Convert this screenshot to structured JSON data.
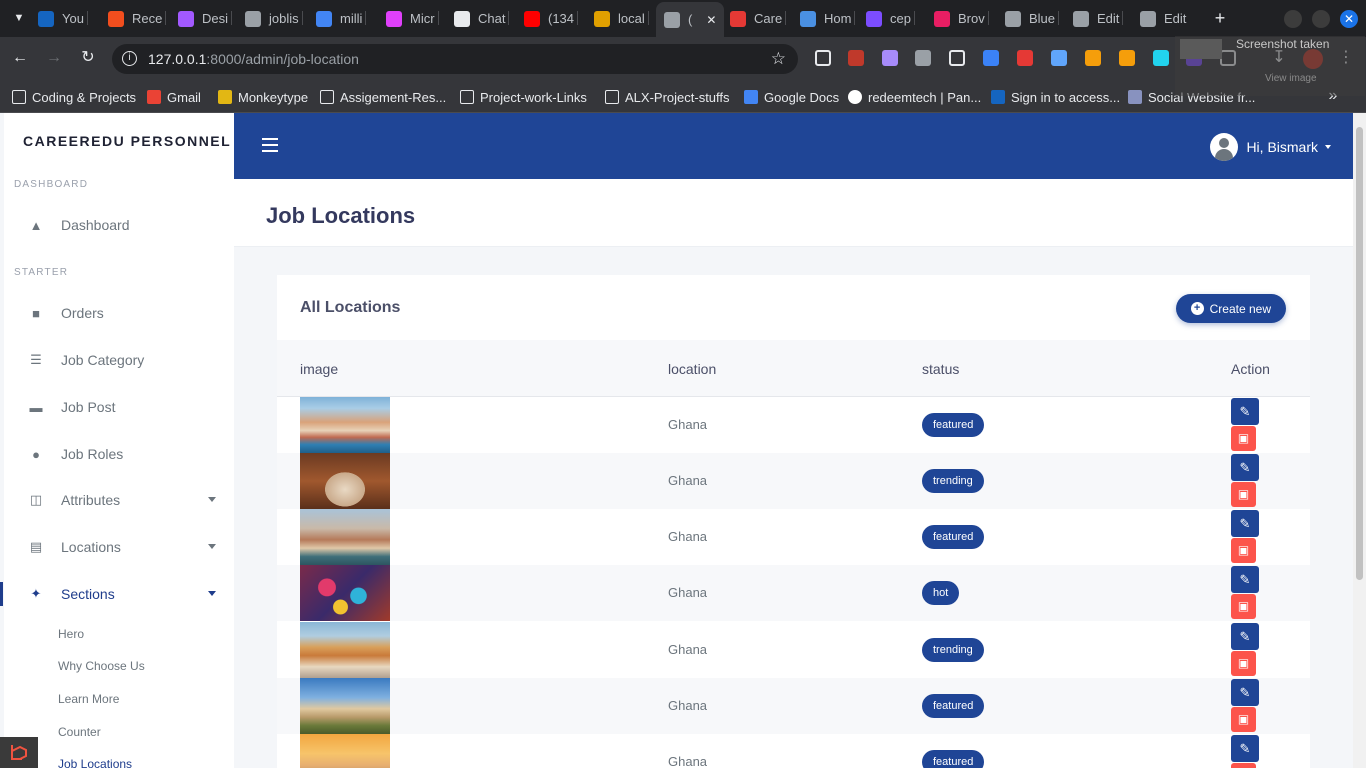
{
  "browser": {
    "tabs": [
      {
        "label": "You",
        "color": "#1565c0"
      },
      {
        "label": "Rece",
        "color": "#f24e1e"
      },
      {
        "label": "Desi",
        "color": "#a259ff"
      },
      {
        "label": "joblis",
        "color": "#9aa0a6"
      },
      {
        "label": "milli",
        "color": "#4285f4"
      },
      {
        "label": "Micr",
        "color": "#e040fb"
      },
      {
        "label": "Chat",
        "color": "#e8eaed"
      },
      {
        "label": "(134",
        "color": "#ff0000"
      },
      {
        "label": "local",
        "color": "#e0a000"
      },
      {
        "label": "(",
        "color": "#9aa0a6"
      },
      {
        "label": "Care",
        "color": "#e53935"
      },
      {
        "label": "Hom",
        "color": "#4a90e2"
      },
      {
        "label": "cep",
        "color": "#7c4dff"
      },
      {
        "label": "Brov",
        "color": "#e91e63"
      },
      {
        "label": "Blue",
        "color": "#9aa0a6"
      },
      {
        "label": "Edit",
        "color": "#9aa0a6"
      },
      {
        "label": "Edit",
        "color": "#9aa0a6"
      }
    ],
    "url_host": "127.0.0.1",
    "url_rest": ":8000/admin/job-location",
    "screenshot_tip": "Screenshot taken",
    "screenshot_sub": "View image",
    "bookmarks": [
      {
        "label": "Coding & Projects",
        "icon": "folder-icon"
      },
      {
        "label": "Gmail",
        "icon": "gmail-icon"
      },
      {
        "label": "Monkeytype",
        "icon": "monkeytype-icon"
      },
      {
        "label": "Assigement-Res...",
        "icon": "folder-icon"
      },
      {
        "label": "Project-work-Links",
        "icon": "folder-icon"
      },
      {
        "label": "ALX-Project-stuffs",
        "icon": "folder-icon"
      },
      {
        "label": "Google Docs",
        "icon": "docs-icon"
      },
      {
        "label": "redeemtech | Pan...",
        "icon": "google-icon"
      },
      {
        "label": "Sign in to access...",
        "icon": "s-icon"
      },
      {
        "label": "Social Website fr...",
        "icon": "php-icon"
      }
    ]
  },
  "sidebar": {
    "brand": "CAREEREDU PERSONNEL",
    "section_dashboard": "DASHBOARD",
    "section_starter": "STARTER",
    "items": [
      {
        "label": "Dashboard",
        "icon": "fire-icon"
      },
      {
        "label": "Orders",
        "icon": "cart-icon"
      },
      {
        "label": "Job Category",
        "icon": "list-icon"
      },
      {
        "label": "Job Post",
        "icon": "briefcase-icon"
      },
      {
        "label": "Job Roles",
        "icon": "user-icon"
      },
      {
        "label": "Attributes",
        "icon": "columns-icon"
      },
      {
        "label": "Locations",
        "icon": "map-icon"
      },
      {
        "label": "Sections",
        "icon": "puzzle-icon"
      }
    ],
    "sub_items": [
      "Hero",
      "Why Choose Us",
      "Learn More",
      "Counter",
      "Job Locations"
    ]
  },
  "topnav": {
    "greeting": "Hi, Bismark"
  },
  "page": {
    "title": "Job Locations"
  },
  "card": {
    "title": "All Locations",
    "create_label": "Create new",
    "columns": [
      "image",
      "location",
      "status",
      "Action"
    ],
    "rows": [
      {
        "location": "Ghana",
        "status": "featured",
        "image": "coastal-village"
      },
      {
        "location": "Ghana",
        "status": "trending",
        "image": "taj-mahal-arch"
      },
      {
        "location": "Ghana",
        "status": "featured",
        "image": "venice-bridge"
      },
      {
        "location": "Ghana",
        "status": "hot",
        "image": "colorful-toys"
      },
      {
        "location": "Ghana",
        "status": "trending",
        "image": "thai-temple"
      },
      {
        "location": "Ghana",
        "status": "featured",
        "image": "acropolis"
      },
      {
        "location": "Ghana",
        "status": "featured",
        "image": "sunset-city"
      }
    ]
  },
  "colors": {
    "primary": "#1f4596",
    "danger": "#fc544b"
  }
}
